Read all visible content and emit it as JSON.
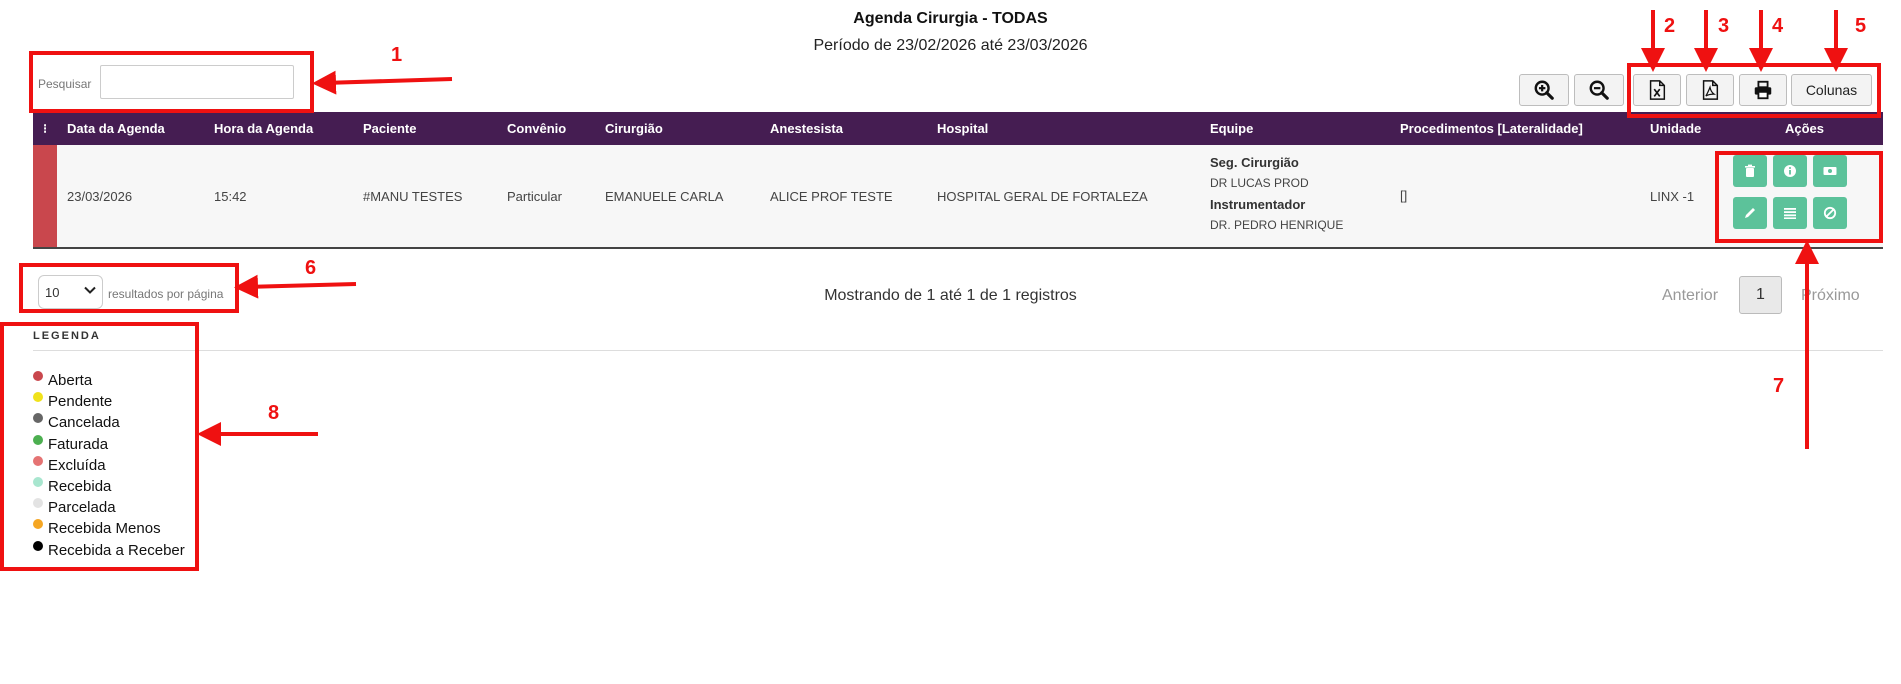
{
  "header": {
    "title": "Agenda Cirurgia - TODAS",
    "period": "Período de 23/02/2026 até 23/03/2026"
  },
  "search": {
    "label": "Pesquisar",
    "value": ""
  },
  "toolbar": {
    "zoom_in_icon": "zoom-in-icon",
    "zoom_out_icon": "zoom-out-icon",
    "excel_icon": "excel-icon",
    "pdf_icon": "pdf-icon",
    "print_icon": "printer-icon",
    "columns_label": "Colunas"
  },
  "table": {
    "columns": [
      "⁝",
      "Data da Agenda",
      "Hora da Agenda",
      "Paciente",
      "Convênio",
      "Cirurgião",
      "Anestesista",
      "Hospital",
      "Equipe",
      "Procedimentos [Lateralidade]",
      "Unidade",
      "Ações"
    ],
    "rows": [
      {
        "status_color": "#c9474d",
        "date": "23/03/2026",
        "time": "15:42",
        "patient": "#MANU TESTES",
        "insurance": "Particular",
        "surgeon": "EMANUELE CARLA",
        "anesthetist": "ALICE PROF TESTE",
        "hospital": "HOSPITAL GERAL DE FORTALEZA",
        "team": [
          {
            "role": "Seg. Cirurgião",
            "name": "DR LUCAS PROD"
          },
          {
            "role": "Instrumentador",
            "name": "DR. PEDRO HENRIQUE"
          }
        ],
        "procedures": "[]",
        "unit": "LINX -1",
        "actions": [
          "trash-icon",
          "info-icon",
          "money-icon",
          "pencil-icon",
          "list-icon",
          "ban-icon"
        ]
      }
    ]
  },
  "pagination": {
    "page_size": "10",
    "page_size_options": [
      "10"
    ],
    "per_page_label": "resultados por página",
    "showing_text": "Mostrando de 1 até 1 de 1 registros",
    "prev_label": "Anterior",
    "current_page": "1",
    "next_label": "Próximo"
  },
  "legend": {
    "title": "LEGENDA",
    "items": [
      {
        "label": "Aberta",
        "color": "#c9474d"
      },
      {
        "label": "Pendente",
        "color": "#f0e21b"
      },
      {
        "label": "Cancelada",
        "color": "#666666"
      },
      {
        "label": "Faturada",
        "color": "#4caf50"
      },
      {
        "label": "Excluída",
        "color": "#e57373"
      },
      {
        "label": "Recebida",
        "color": "#a8e6cf"
      },
      {
        "label": "Parcelada",
        "color": "#e3e3e3"
      },
      {
        "label": "Recebida Menos",
        "color": "#f5a623"
      },
      {
        "label": "Recebida a Receber",
        "color": "#000000"
      }
    ]
  },
  "annotations": {
    "color": "#ef1111",
    "labels": [
      "1",
      "2",
      "3",
      "4",
      "5",
      "6",
      "7",
      "8"
    ]
  }
}
